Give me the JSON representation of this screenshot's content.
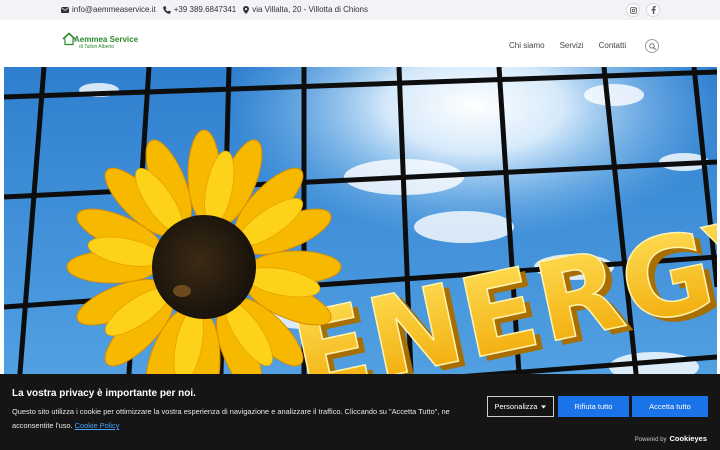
{
  "topbar": {
    "email": "info@aemmeaservice.it",
    "phone": "+39 389.6847341",
    "address": "via Villalta, 20 - Villotta di Chions",
    "icons": [
      "envelope-icon",
      "phone-icon",
      "map-pin-icon",
      "instagram-icon",
      "facebook-icon"
    ]
  },
  "logo": {
    "name": "Aemmea Service",
    "subtitle": "di Tallon Alberto",
    "color": "#2c8a2e"
  },
  "nav": {
    "items": [
      "Chi siamo",
      "Servizi",
      "Contatti"
    ]
  },
  "hero": {
    "text": "ENERGY",
    "sky_color": "#3d8fd6",
    "letter_color": "#f5c21a"
  },
  "cookie": {
    "title": "La vostra privacy è importante per noi.",
    "text": "Questo sito utilizza i cookie per ottimizzare la vostra esperienza di navigazione e analizzare il traffico. Cliccando su \"Accetta Tutto\", ne acconsentite l'uso.",
    "link": "Cookie Policy",
    "customize": "Personalizza",
    "reject": "Rifiuta tutto",
    "accept": "Accetta tutto",
    "powered_label": "Powered by",
    "powered_brand": "Cookieyes",
    "accent": "#1a73e8"
  }
}
